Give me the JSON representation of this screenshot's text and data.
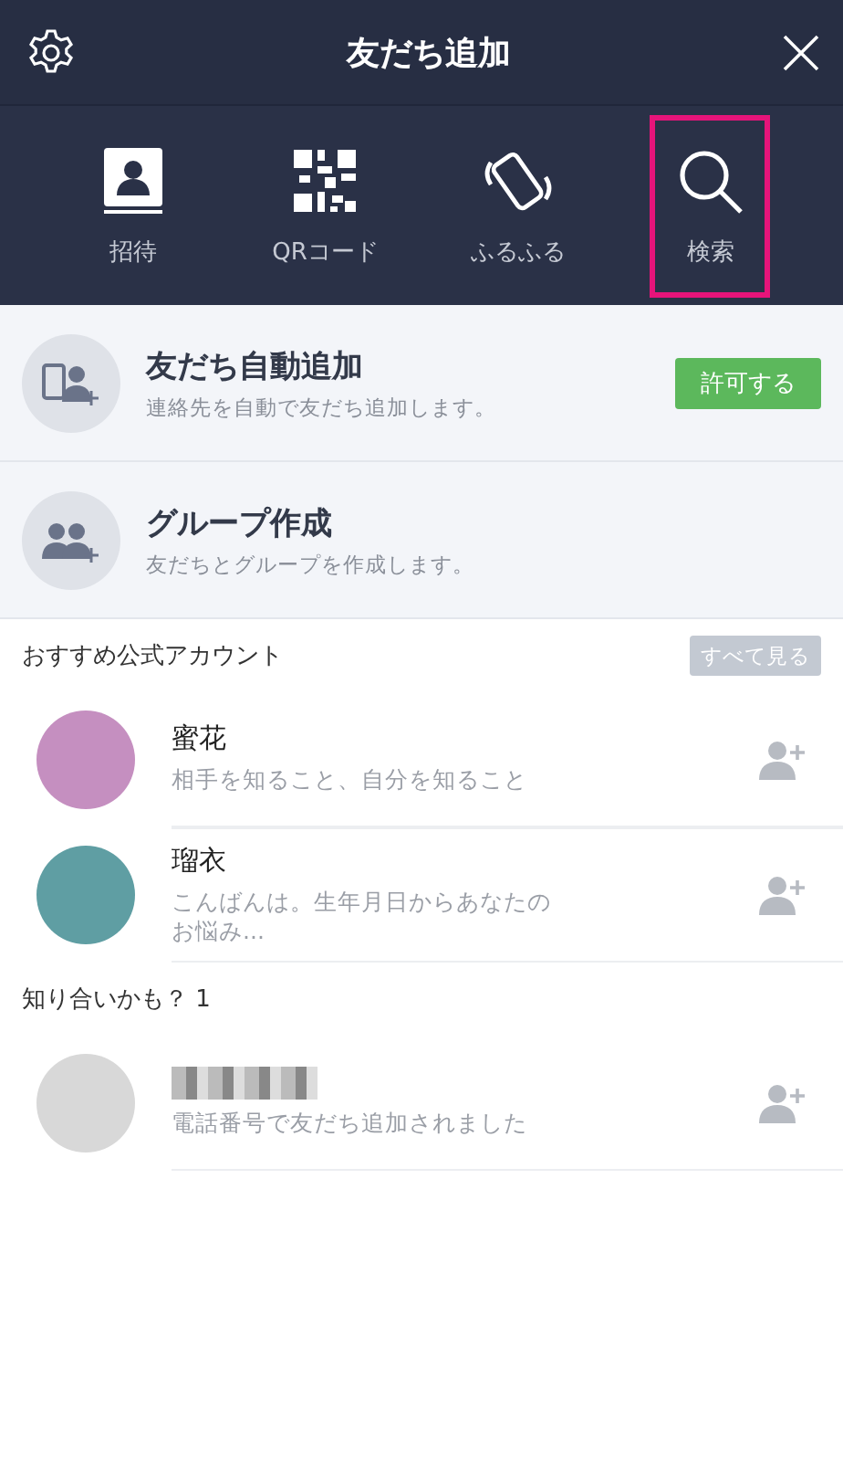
{
  "header": {
    "title": "友だち追加"
  },
  "tabs": [
    {
      "kind": "invite",
      "label": "招待",
      "selected": false
    },
    {
      "kind": "qr",
      "label": "QRコード",
      "selected": false
    },
    {
      "kind": "shake",
      "label": "ふるふる",
      "selected": false
    },
    {
      "kind": "search",
      "label": "検索",
      "selected": true
    }
  ],
  "actions": [
    {
      "kind": "auto",
      "title": "友だち自動追加",
      "subtitle": "連絡先を自動で友だち追加します。",
      "button": "許可する"
    },
    {
      "kind": "group",
      "title": "グループ作成",
      "subtitle": "友だちとグループを作成します。"
    }
  ],
  "sections": [
    {
      "title": "おすすめ公式アカウント",
      "button": "すべて見る",
      "rows": [
        {
          "name": "蜜花",
          "status": "相手を知ること、自分を知ること",
          "color": "#c58fc0"
        },
        {
          "name": "瑠衣",
          "status": "こんばんは。生年月日からあなたのお悩み...",
          "color": "#5f9ea3"
        }
      ]
    },
    {
      "title": "知り合いかも？ 1",
      "rows": [
        {
          "name_hidden": true,
          "status": "電話番号で友だち追加されました",
          "color": "#d8d8d8"
        }
      ]
    }
  ]
}
